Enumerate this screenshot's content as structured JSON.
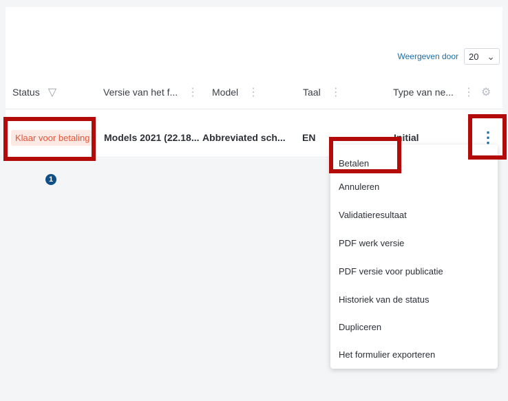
{
  "pager": {
    "label": "Weergeven door",
    "value": "20"
  },
  "table": {
    "columns": [
      "Status",
      "Versie van het f...",
      "Model",
      "Taal",
      "Type van ne..."
    ],
    "row": {
      "status": "Klaar voor betaling",
      "version": "Models 2021 (22.18...",
      "model": "Abbreviated sch...",
      "language": "EN",
      "type": "Initial"
    }
  },
  "step_badge": "1",
  "menu": {
    "items": [
      "Betalen",
      "Annuleren",
      "Validatieresultaat",
      "PDF werk versie",
      "PDF versie voor publicatie",
      "Historiek van de status",
      "Dupliceren",
      "Het formulier exporteren"
    ]
  },
  "colors": {
    "highlight": "#b30a0a",
    "status_badge_bg": "#fde9e4",
    "status_badge_text": "#e2553a",
    "accent": "#1669a6"
  },
  "icons": {
    "filter": "filter-icon",
    "column_menu": "vertical-dots-icon",
    "settings": "gear-icon",
    "dropdown": "chevron-down-icon",
    "row_actions": "kebab-icon"
  }
}
